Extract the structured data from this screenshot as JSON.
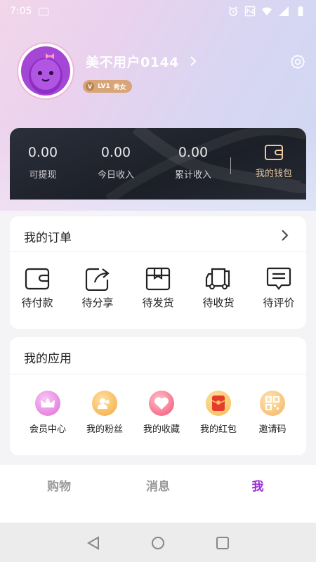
{
  "status_bar": {
    "time": "7:05"
  },
  "profile": {
    "username": "美不用户0144",
    "level": "LV1",
    "level_title": "秀女"
  },
  "wallet": {
    "stats": [
      {
        "value": "0.00",
        "label": "可提现"
      },
      {
        "value": "0.00",
        "label": "今日收入"
      },
      {
        "value": "0.00",
        "label": "累计收入"
      }
    ],
    "wallet_label": "我的钱包"
  },
  "orders": {
    "title": "我的订单",
    "items": [
      {
        "label": "待付款",
        "icon": "wallet-icon"
      },
      {
        "label": "待分享",
        "icon": "share-icon"
      },
      {
        "label": "待发货",
        "icon": "box-icon"
      },
      {
        "label": "待收货",
        "icon": "truck-icon"
      },
      {
        "label": "待评价",
        "icon": "comment-icon"
      }
    ]
  },
  "apps": {
    "title": "我的应用",
    "items": [
      {
        "label": "会员中心",
        "icon": "crown-icon"
      },
      {
        "label": "我的粉丝",
        "icon": "fans-icon"
      },
      {
        "label": "我的收藏",
        "icon": "heart-icon"
      },
      {
        "label": "我的红包",
        "icon": "red-envelope-icon"
      },
      {
        "label": "邀请码",
        "icon": "qr-code-icon"
      }
    ]
  },
  "tabs": [
    {
      "label": "购物",
      "active": false
    },
    {
      "label": "消息",
      "active": false
    },
    {
      "label": "我",
      "active": true
    }
  ],
  "colors": {
    "accent": "#9b2bd6",
    "wallet_gold": "#e8c9a6",
    "badge": "#d7a577"
  }
}
